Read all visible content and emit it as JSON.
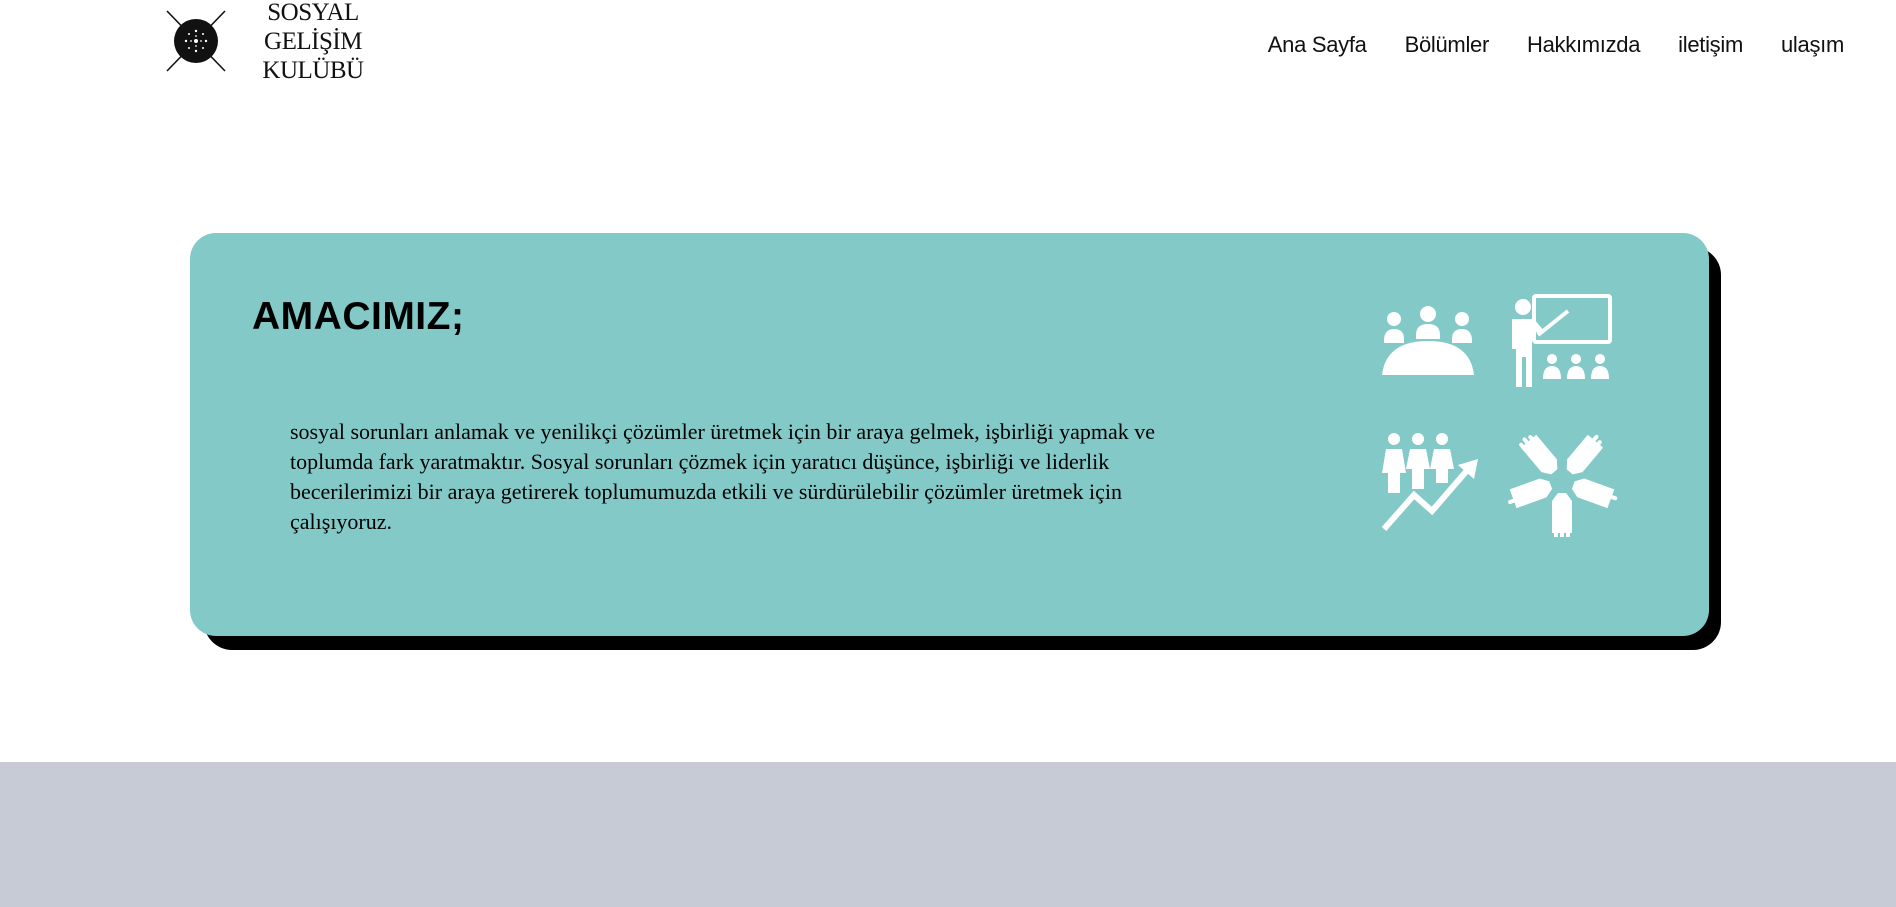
{
  "logo": {
    "line1": "SOSYAL GELİŞİM",
    "line2": "KULÜBÜ"
  },
  "nav": {
    "items": [
      "Ana Sayfa",
      "Bölümler",
      "Hakkımızda",
      "iletişim",
      "ulaşım"
    ]
  },
  "card": {
    "title": "AMACIMIZ;",
    "body": "sosyal sorunları anlamak ve yenilikçi çözümler üretmek için bir araya gelmek, işbirliği yapmak ve toplumda fark yaratmaktır. Sosyal sorunları çözmek için yaratıcı düşünce, işbirliği ve liderlik becerilerimizi bir araya getirerek toplumumuzda etkili ve sürdürülebilir çözümler üretmek için çalışıyoruz.",
    "background_color": "#83c9c8",
    "shadow_color": "#000000",
    "icons": [
      "meeting-group-icon",
      "teacher-presentation-icon",
      "team-growth-icon",
      "teamwork-hands-icon"
    ]
  },
  "footer": {
    "background_color": "#c6cbd5"
  }
}
